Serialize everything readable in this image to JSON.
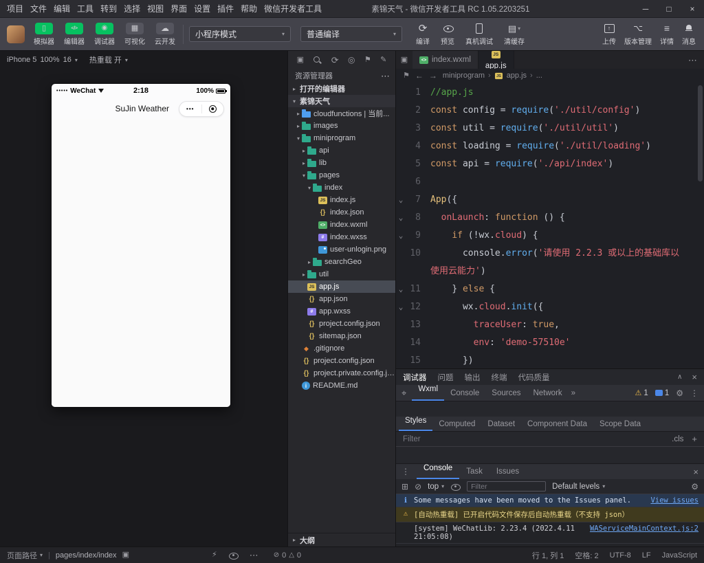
{
  "titlebar": {
    "menus": [
      "项目",
      "文件",
      "编辑",
      "工具",
      "转到",
      "选择",
      "视图",
      "界面",
      "设置",
      "插件",
      "帮助",
      "微信开发者工具"
    ],
    "title": "素锦天气 - 微信开发者工具 RC 1.05.2203251"
  },
  "toolbar": {
    "toggles": [
      {
        "label": "模拟器",
        "icon": "simulator-icon",
        "active": true
      },
      {
        "label": "编辑器",
        "icon": "editor-icon",
        "active": true
      },
      {
        "label": "调试器",
        "icon": "debugger-icon",
        "active": true
      },
      {
        "label": "可视化",
        "icon": "visual-icon",
        "active": false
      },
      {
        "label": "云开发",
        "icon": "cloud-icon",
        "active": false
      }
    ],
    "mode_select": "小程序模式",
    "compile_select": "普通编译",
    "actions": [
      {
        "label": "编译",
        "icon": "compile-icon"
      },
      {
        "label": "预览",
        "icon": "preview-icon"
      },
      {
        "label": "真机调试",
        "icon": "device-debug-icon"
      },
      {
        "label": "清缓存",
        "icon": "clear-cache-icon",
        "caret": true
      }
    ],
    "right_actions": [
      {
        "label": "上传",
        "icon": "upload-icon"
      },
      {
        "label": "版本管理",
        "icon": "version-icon"
      },
      {
        "label": "详情",
        "icon": "details-icon"
      },
      {
        "label": "消息",
        "icon": "message-icon"
      }
    ]
  },
  "simulator": {
    "device": "iPhone 5",
    "zoom": "100%",
    "client": "16",
    "hot_reload": "热重载 开",
    "phone": {
      "carrier": "WeChat",
      "time": "2:18",
      "battery": "100%",
      "title": "SuJin Weather"
    }
  },
  "explorer": {
    "header_icons": [
      "copy-icon",
      "search-icon",
      "refresh-icon",
      "target-icon",
      "bookmark-icon",
      "brush-icon"
    ],
    "panel_title": "资源管理器",
    "open_editors_label": "打开的编辑器",
    "project_label": "素锦天气",
    "tree": [
      {
        "indent": 1,
        "arrow": "right",
        "icon": "folder-cloud",
        "label": "cloudfunctions | 当前..."
      },
      {
        "indent": 1,
        "arrow": "right",
        "icon": "folder",
        "label": "images"
      },
      {
        "indent": 1,
        "arrow": "down",
        "icon": "folder",
        "label": "miniprogram"
      },
      {
        "indent": 2,
        "arrow": "right",
        "icon": "folder",
        "label": "api"
      },
      {
        "indent": 2,
        "arrow": "right",
        "icon": "folder",
        "label": "lib"
      },
      {
        "indent": 2,
        "arrow": "down",
        "icon": "folder",
        "label": "pages"
      },
      {
        "indent": 3,
        "arrow": "down",
        "icon": "folder",
        "label": "index"
      },
      {
        "indent": 4,
        "arrow": null,
        "icon": "js",
        "label": "index.js"
      },
      {
        "indent": 4,
        "arrow": null,
        "icon": "json",
        "label": "index.json"
      },
      {
        "indent": 4,
        "arrow": null,
        "icon": "wxml",
        "label": "index.wxml"
      },
      {
        "indent": 4,
        "arrow": null,
        "icon": "wxss",
        "label": "index.wxss"
      },
      {
        "indent": 4,
        "arrow": null,
        "icon": "img",
        "label": "user-unlogin.png"
      },
      {
        "indent": 3,
        "arrow": "right",
        "icon": "folder",
        "label": "searchGeo"
      },
      {
        "indent": 2,
        "arrow": "right",
        "icon": "folder",
        "label": "util"
      },
      {
        "indent": 2,
        "arrow": null,
        "icon": "js",
        "label": "app.js",
        "selected": true
      },
      {
        "indent": 2,
        "arrow": null,
        "icon": "json",
        "label": "app.json"
      },
      {
        "indent": 2,
        "arrow": null,
        "icon": "wxss",
        "label": "app.wxss"
      },
      {
        "indent": 2,
        "arrow": null,
        "icon": "json",
        "label": "project.config.json"
      },
      {
        "indent": 2,
        "arrow": null,
        "icon": "json",
        "label": "sitemap.json"
      },
      {
        "indent": 1,
        "arrow": null,
        "icon": "git",
        "label": ".gitignore"
      },
      {
        "indent": 1,
        "arrow": null,
        "icon": "json",
        "label": "project.config.json"
      },
      {
        "indent": 1,
        "arrow": null,
        "icon": "json",
        "label": "project.private.config.js..."
      },
      {
        "indent": 1,
        "arrow": null,
        "icon": "info",
        "label": "README.md"
      }
    ],
    "outline_label": "大纲"
  },
  "editor": {
    "tabs": [
      {
        "label": "index.wxml",
        "icon": "wxml",
        "active": false,
        "close": false
      },
      {
        "label": "app.js",
        "icon": "js",
        "active": true,
        "close": true
      }
    ],
    "tab_actions": [
      "split-editor-icon",
      "more-icon"
    ],
    "breadcrumb": [
      {
        "label": "miniprogram"
      },
      {
        "label": "app.js",
        "icon": "js"
      },
      {
        "label": "..."
      }
    ],
    "lines": [
      {
        "num": 1,
        "fold": false,
        "tokens": [
          [
            "c",
            "//app.js"
          ]
        ]
      },
      {
        "num": 2,
        "fold": false,
        "tokens": [
          [
            "k",
            "const "
          ],
          [
            "n",
            "config "
          ],
          [
            "n",
            "= "
          ],
          [
            "f",
            "require"
          ],
          [
            "n",
            "("
          ],
          [
            "s",
            "'./util/config'"
          ],
          [
            "n",
            ")"
          ]
        ]
      },
      {
        "num": 3,
        "fold": false,
        "tokens": [
          [
            "k",
            "const "
          ],
          [
            "n",
            "util "
          ],
          [
            "n",
            "= "
          ],
          [
            "f",
            "require"
          ],
          [
            "n",
            "("
          ],
          [
            "s",
            "'./util/util'"
          ],
          [
            "n",
            ")"
          ]
        ]
      },
      {
        "num": 4,
        "fold": false,
        "tokens": [
          [
            "k",
            "const "
          ],
          [
            "n",
            "loading "
          ],
          [
            "n",
            "= "
          ],
          [
            "f",
            "require"
          ],
          [
            "n",
            "("
          ],
          [
            "s",
            "'./util/loading'"
          ],
          [
            "n",
            ")"
          ]
        ]
      },
      {
        "num": 5,
        "fold": false,
        "tokens": [
          [
            "k",
            "const "
          ],
          [
            "n",
            "api "
          ],
          [
            "n",
            "= "
          ],
          [
            "f",
            "require"
          ],
          [
            "n",
            "("
          ],
          [
            "s",
            "'./api/index'"
          ],
          [
            "n",
            ")"
          ]
        ]
      },
      {
        "num": 6,
        "fold": false,
        "tokens": []
      },
      {
        "num": 7,
        "fold": true,
        "tokens": [
          [
            "y",
            "App"
          ],
          [
            "n",
            "({"
          ]
        ]
      },
      {
        "num": 8,
        "fold": true,
        "tokens": [
          [
            "n",
            "  "
          ],
          [
            "p",
            "onLaunch"
          ],
          [
            "n",
            ": "
          ],
          [
            "k",
            "function"
          ],
          [
            "n",
            " () {"
          ]
        ]
      },
      {
        "num": 9,
        "fold": true,
        "tokens": [
          [
            "n",
            "    "
          ],
          [
            "k",
            "if"
          ],
          [
            "n",
            " (!wx."
          ],
          [
            "p",
            "cloud"
          ],
          [
            "n",
            ") {"
          ]
        ]
      },
      {
        "num": 10,
        "fold": false,
        "tokens": [
          [
            "n",
            "      console."
          ],
          [
            "f",
            "error"
          ],
          [
            "n",
            "("
          ],
          [
            "s",
            "'请使用 2.2.3 或以上的基础库以使用云能力'"
          ],
          [
            "n",
            ")"
          ]
        ]
      },
      {
        "num": 11,
        "fold": true,
        "tokens": [
          [
            "n",
            "    } "
          ],
          [
            "k",
            "else"
          ],
          [
            "n",
            " {"
          ]
        ]
      },
      {
        "num": 12,
        "fold": true,
        "tokens": [
          [
            "n",
            "      wx."
          ],
          [
            "p",
            "cloud"
          ],
          [
            "n",
            "."
          ],
          [
            "f",
            "init"
          ],
          [
            "n",
            "({"
          ]
        ]
      },
      {
        "num": 13,
        "fold": false,
        "tokens": [
          [
            "n",
            "        "
          ],
          [
            "p",
            "traceUser"
          ],
          [
            "n",
            ": "
          ],
          [
            "b",
            "true"
          ],
          [
            "n",
            ","
          ]
        ]
      },
      {
        "num": 14,
        "fold": false,
        "tokens": [
          [
            "n",
            "        "
          ],
          [
            "p",
            "env"
          ],
          [
            "n",
            ": "
          ],
          [
            "s",
            "'demo-57510e'"
          ]
        ]
      },
      {
        "num": 15,
        "fold": false,
        "tokens": [
          [
            "n",
            "      })"
          ]
        ]
      }
    ]
  },
  "debugpanel": {
    "tabs": [
      {
        "label": "调试器",
        "active": true
      },
      {
        "label": "问题"
      },
      {
        "label": "输出"
      },
      {
        "label": "终端"
      },
      {
        "label": "代码质量"
      }
    ],
    "devtools_tabs": [
      {
        "label": "Wxml",
        "active": true
      },
      {
        "label": "Console"
      },
      {
        "label": "Sources"
      },
      {
        "label": "Network"
      }
    ],
    "overflow_label": "»",
    "warning_count": "1",
    "issues_count": "1",
    "style_tabs": [
      {
        "label": "Styles",
        "active": true
      },
      {
        "label": "Computed"
      },
      {
        "label": "Dataset"
      },
      {
        "label": "Component Data"
      },
      {
        "label": "Scope Data"
      }
    ],
    "styles_filter_placeholder": "Filter",
    "cls_label": ".cls",
    "console": {
      "tabs": [
        {
          "label": "Console",
          "active": true
        },
        {
          "label": "Task"
        },
        {
          "label": "Issues"
        }
      ],
      "toolbar_icons": [
        "dock-icon",
        "clear-icon"
      ],
      "context": "top",
      "filter_placeholder": "Filter",
      "levels_label": "Default levels",
      "messages": [
        {
          "type": "info",
          "text": "Some messages have been moved to the Issues panel.",
          "link": "View issues"
        },
        {
          "type": "warning",
          "text": "[自动热重载] 已开启代码文件保存后自动热重载（不支持 json）"
        },
        {
          "type": "log",
          "text": "[system] WeChatLib: 2.23.4 (2022.4.11 21:05:08)",
          "source": "WAServiceMainContext.js:2"
        }
      ],
      "prompt": "›"
    }
  },
  "statusbar": {
    "page_path_label": "页面路径",
    "page_path": "pages/index/index",
    "icons": [
      "lightning-icon",
      "eye-icon",
      "more-icon"
    ],
    "errors": "0",
    "warnings": "0",
    "cursor": "行 1, 列 1",
    "indent": "空格: 2",
    "encoding": "UTF-8",
    "eol": "LF",
    "language": "JavaScript"
  }
}
